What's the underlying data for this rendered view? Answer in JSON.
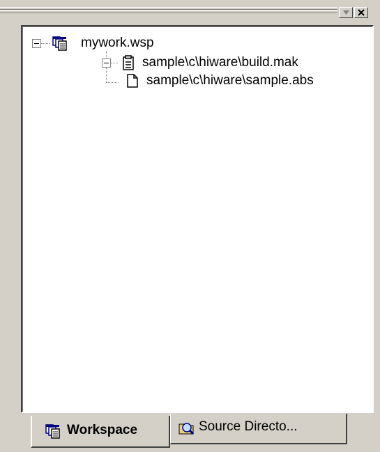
{
  "tree": {
    "root": {
      "label": "mywork.wsp",
      "icon": "workspace-icon"
    },
    "child": {
      "label": "sample\\c\\hiware\\build.mak",
      "icon": "makefile-icon"
    },
    "leaf": {
      "label": "sample\\c\\hiware\\sample.abs",
      "icon": "document-icon"
    }
  },
  "tabs": [
    {
      "label": "Workspace",
      "icon": "workspace-icon",
      "active": true
    },
    {
      "label": "Source Directo...",
      "icon": "magnifier-folder-icon",
      "active": false
    }
  ],
  "dock": {
    "buttons": [
      "menu-arrow-icon",
      "close-icon"
    ]
  }
}
